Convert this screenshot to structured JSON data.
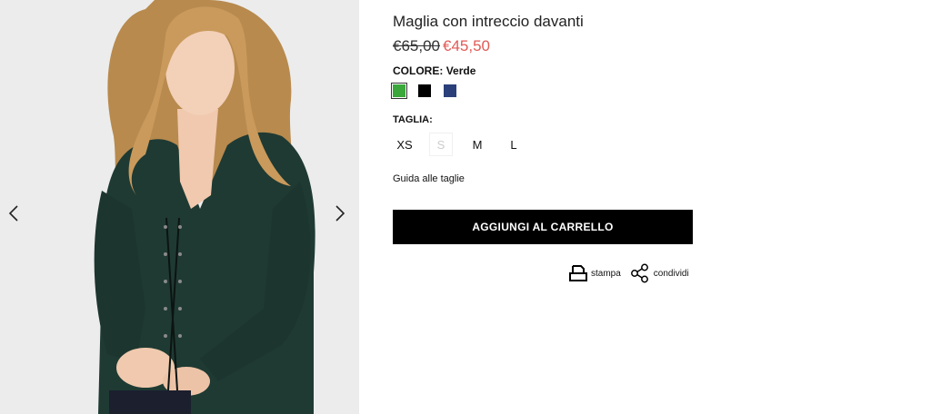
{
  "product": {
    "title": "Maglia con intreccio davanti",
    "price_old": "€65,00",
    "price_new": "€45,50"
  },
  "color": {
    "label": "COLORE:",
    "selected": "Verde",
    "swatches": [
      {
        "name": "Verde",
        "hex": "#3aa83a",
        "selected": true
      },
      {
        "name": "Nero",
        "hex": "#000000",
        "selected": false
      },
      {
        "name": "Blu",
        "hex": "#2b3f7a",
        "selected": false
      }
    ]
  },
  "size": {
    "label": "TAGLIA:",
    "options": [
      {
        "label": "XS",
        "available": true
      },
      {
        "label": "S",
        "available": false
      },
      {
        "label": "M",
        "available": true
      },
      {
        "label": "L",
        "available": true
      }
    ]
  },
  "size_guide": "Guida alle taglie",
  "cart_button": "AGGIUNGI AL CARRELLO",
  "actions": {
    "print": "stampa",
    "share": "condividi"
  },
  "gallery": {
    "prev_icon": "chevron-left-icon",
    "next_icon": "chevron-right-icon"
  },
  "colors": {
    "accent_price": "#e15a55",
    "button_bg": "#000000",
    "sweater": "#1f3a33"
  }
}
